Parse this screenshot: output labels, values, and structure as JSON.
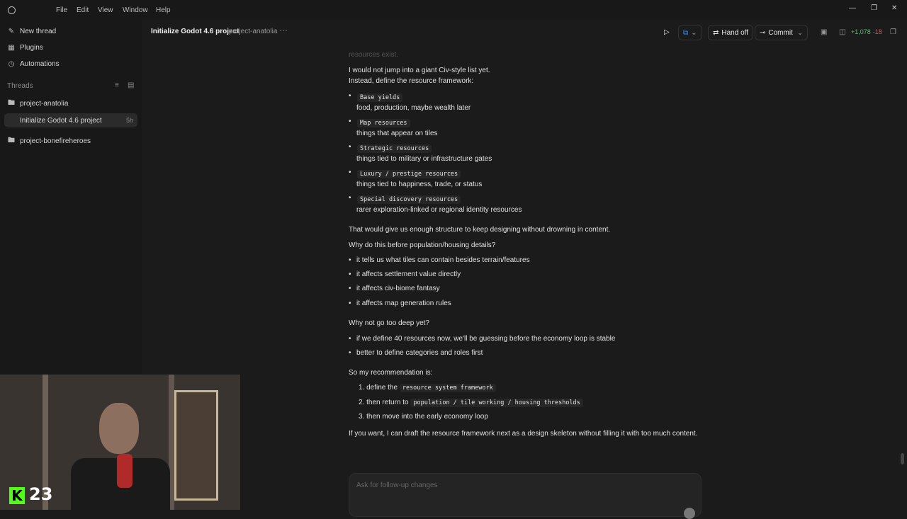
{
  "menu": [
    "File",
    "Edit",
    "View",
    "Window",
    "Help"
  ],
  "sidebar": {
    "actions": [
      {
        "label": "New thread",
        "icon": "pencil-icon"
      },
      {
        "label": "Plugins",
        "icon": "grid-icon"
      },
      {
        "label": "Automations",
        "icon": "clock-icon"
      }
    ],
    "threads_label": "Threads",
    "projects": [
      {
        "label": "project-anatolia"
      },
      {
        "label": "Initialize Godot 4.6 project",
        "age": "5h"
      },
      {
        "label": "project-bonefireheroes"
      }
    ]
  },
  "header": {
    "title": "Initialize Godot 4.6 project",
    "project": "project-anatolia",
    "more": "···",
    "hand_off": "Hand off",
    "commit": "Commit",
    "diff_add": "+1,078",
    "diff_del": "-18"
  },
  "content": {
    "faded_tail": "resources exist.",
    "intro1": "I would not jump into a giant Civ-style list yet.",
    "intro2": "Instead, define the resource framework:",
    "framework": [
      {
        "title": "Base yields",
        "desc": "food, production, maybe wealth later"
      },
      {
        "title": "Map resources",
        "desc": "things that appear on tiles"
      },
      {
        "title": "Strategic resources",
        "desc": "things tied to military or infrastructure gates"
      },
      {
        "title": "Luxury / prestige resources",
        "desc": "things tied to happiness, trade, or status"
      },
      {
        "title": "Special discovery resources",
        "desc": "rarer exploration-linked or regional identity resources"
      }
    ],
    "structure_note": "That would give us enough structure to keep designing without drowning in content.",
    "why_q": "Why do this before population/housing details?",
    "why_list": [
      "it tells us what tiles can contain besides terrain/features",
      "it affects settlement value directly",
      "it affects civ-biome fantasy",
      "it affects map generation rules"
    ],
    "why_not_q": "Why not go too deep yet?",
    "why_not_list": [
      "if we define 40 resources now, we'll be guessing before the economy loop is stable",
      "better to define categories and roles first"
    ],
    "recommend": "So my recommendation is:",
    "steps": [
      {
        "prefix": "1. define the ",
        "code": "resource system framework"
      },
      {
        "prefix": "2. then return to ",
        "code": "population / tile working / housing thresholds"
      },
      {
        "prefix": "3. then move into the early economy loop",
        "code": ""
      }
    ],
    "closing": "If you want, I can draft the resource framework next as a design skeleton without filling it with too much content."
  },
  "composer": {
    "placeholder": "Ask for follow-up changes"
  },
  "overlay": {
    "viewer_count": "23",
    "logo": "K"
  }
}
